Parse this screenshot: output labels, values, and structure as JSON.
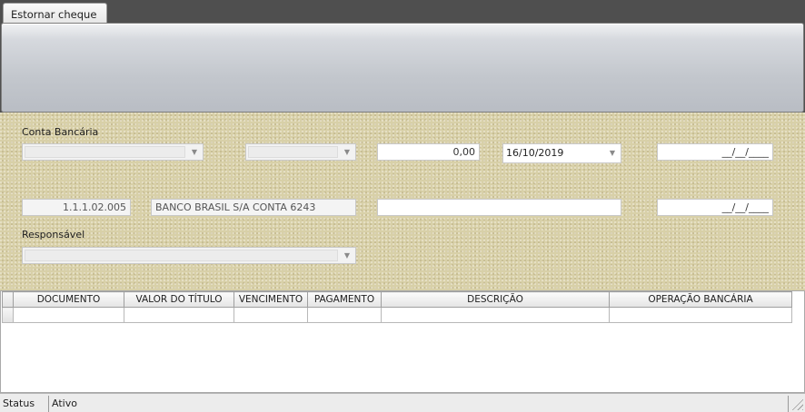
{
  "tabs": [
    {
      "label": "Estornar cheque"
    }
  ],
  "form": {
    "conta_label": "Conta Bancária",
    "combo1_value": "",
    "combo2_value": "",
    "valor": "0,00",
    "data": "16/10/2019",
    "data_end1": "__/__/____",
    "codigo": "1.1.1.02.005",
    "conta_descricao": "BANCO BRASIL S/A CONTA 6243",
    "campo_vazio": "",
    "data_end2": "__/__/____",
    "responsavel_label": "Responsável",
    "responsavel_value": ""
  },
  "grid": {
    "columns": [
      "DOCUMENTO",
      "VALOR DO TÍTULO",
      "VENCIMENTO",
      "PAGAMENTO",
      "DESCRIÇÃO",
      "OPERAÇÃO BANCÁRIA"
    ]
  },
  "statusbar": {
    "status_label": "Status",
    "status_value": "Ativo"
  },
  "icons": {
    "dropdown": "chevron-down-icon",
    "resize": "resize-grip-icon"
  }
}
